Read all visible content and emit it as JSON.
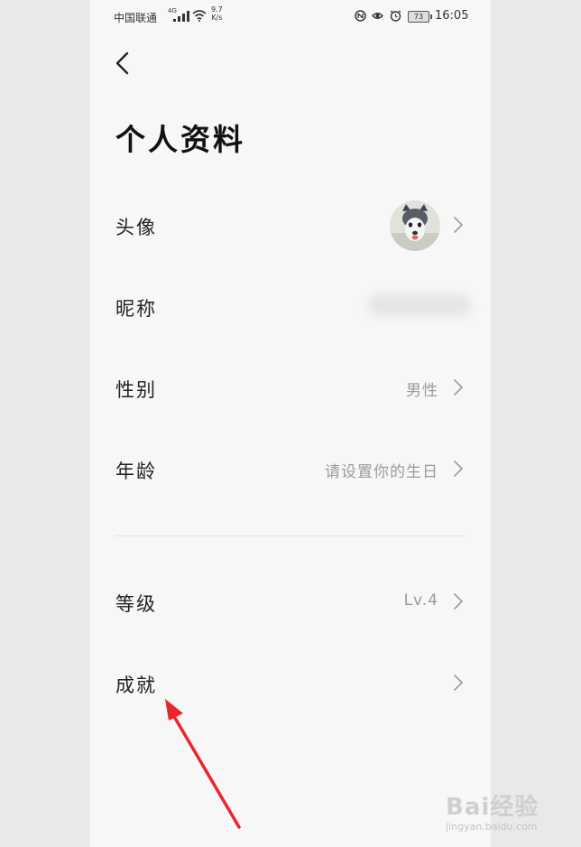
{
  "status_bar": {
    "carrier": "中国联通",
    "network_gen": "4G",
    "speed_value": "9.7",
    "speed_unit": "K/s",
    "battery": "73",
    "time": "16:05"
  },
  "header": {
    "back_icon": "chevron-left-icon",
    "title": "个人资料"
  },
  "profile_rows": [
    {
      "label": "头像",
      "value": "",
      "type": "avatar"
    },
    {
      "label": "昵称",
      "value": "",
      "type": "blurred"
    },
    {
      "label": "性别",
      "value": "男性"
    },
    {
      "label": "年龄",
      "value": "请设置你的生日"
    }
  ],
  "extra_rows": [
    {
      "label": "等级",
      "value": "Lv.4"
    },
    {
      "label": "成就",
      "value": ""
    }
  ],
  "watermark": {
    "main": "Bai经验",
    "url": "jingyan.baidu.com"
  },
  "colors": {
    "page_bg": "#f7f7f7",
    "outer_bg": "#e9e9e9",
    "title": "#111111",
    "secondary_text": "#9a9a9a",
    "annotation_arrow": "#e8262b"
  }
}
